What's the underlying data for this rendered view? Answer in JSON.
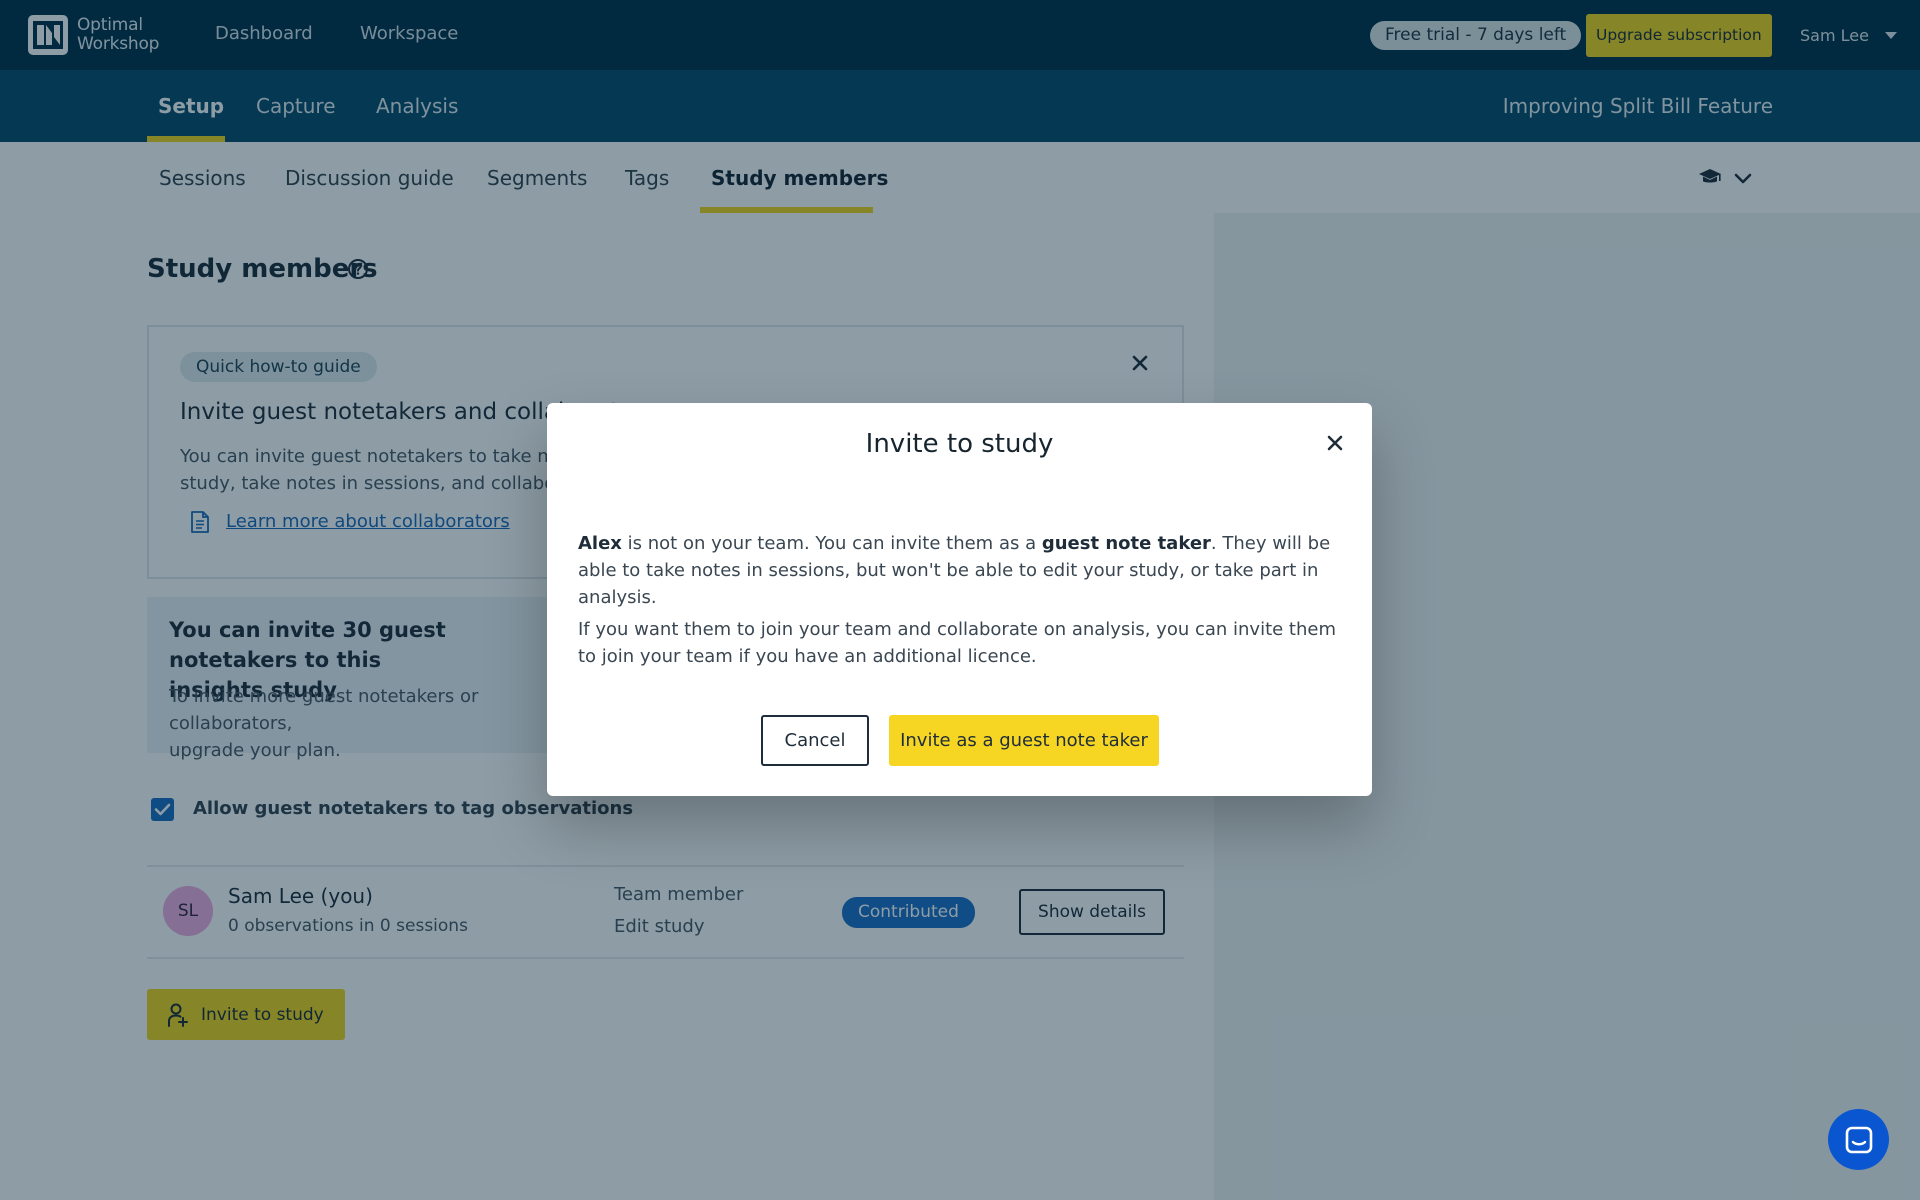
{
  "app": {
    "logo_line1": "Optimal",
    "logo_line2": "Workshop",
    "nav": [
      "Dashboard",
      "Workspace"
    ],
    "trial_badge": "Free trial - 7 days left",
    "upgrade_label": "Upgrade subscription",
    "user_name": "Sam Lee"
  },
  "subnav": {
    "tabs": [
      "Setup",
      "Capture",
      "Analysis"
    ],
    "active_tab": "Setup",
    "study_name": "Improving Split Bill Feature"
  },
  "tabs": {
    "items": [
      "Sessions",
      "Discussion guide",
      "Segments",
      "Tags",
      "Study members"
    ],
    "active": "Study members"
  },
  "page": {
    "title": "Study members"
  },
  "guide": {
    "badge": "Quick how-to guide",
    "heading": "Invite guest notetakers and collaborators",
    "body_line1": "You can invite guest notetakers to take notes on",
    "body_line2": "study, take notes in sessions, and collaborate on",
    "link": "Learn more about collaborators"
  },
  "limit": {
    "heading_line1": "You can invite 30 guest notetakers to this",
    "heading_line2": "insights study",
    "body_line1": "To invite more guest notetakers or collaborators,",
    "body_line2": "upgrade your plan."
  },
  "settings": {
    "allow_tagging_label": "Allow guest notetakers to tag observations",
    "allow_tagging_checked": true
  },
  "members": [
    {
      "initials": "SL",
      "name": "Sam Lee (you)",
      "stats": "0 observations in 0 sessions",
      "role": "Team member",
      "permission": "Edit study",
      "status": "Contributed",
      "action": "Show details"
    }
  ],
  "invite_button": "Invite to study",
  "modal": {
    "title": "Invite to study",
    "p1_name": "Alex",
    "p1_part1": " is not on your team. You can invite them as a ",
    "p1_bold": "guest note taker",
    "p1_part2": ". They will be able to take notes in sessions, but won't be able to edit your study, or take part in analysis.",
    "p2": "If you want them to join your team and collaborate on analysis, you can invite them to join your team if you have an additional licence.",
    "cancel_label": "Cancel",
    "confirm_label": "Invite as a guest note taker"
  },
  "colors": {
    "topbar": "#01304a",
    "subbar": "#074a6a",
    "accent_yellow": "#f3d51a",
    "link_blue": "#1d69b7",
    "badge_blue": "#1d6ec5"
  }
}
